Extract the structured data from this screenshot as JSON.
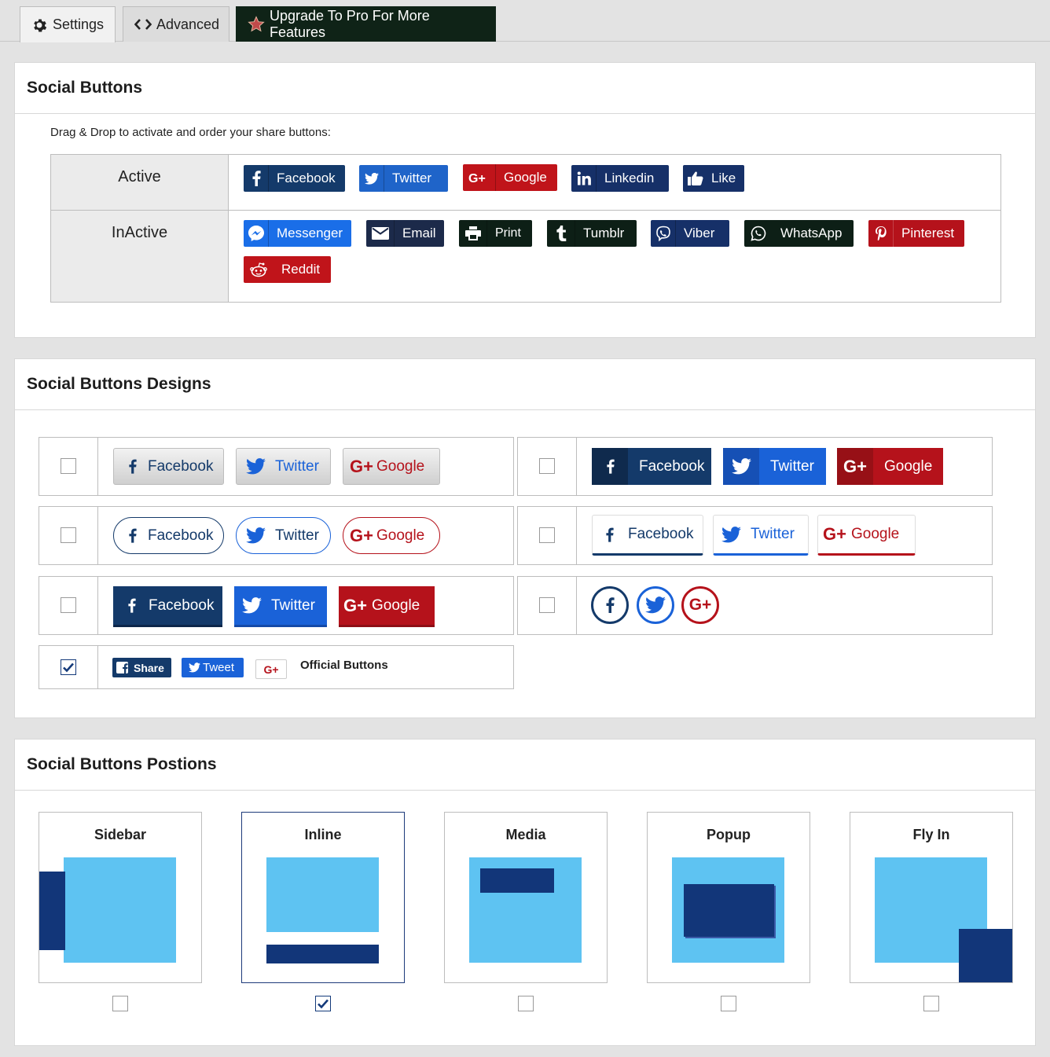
{
  "tabs": {
    "settings": "Settings",
    "advanced": "Advanced",
    "pro": "Upgrade To Pro For More Features"
  },
  "social_buttons": {
    "title": "Social Buttons",
    "instruction": "Drag & Drop to activate and order your share buttons:",
    "active_label": "Active",
    "inactive_label": "InActive",
    "active": [
      {
        "label": "Facebook",
        "icon": "facebook-icon",
        "color": "#143a6a"
      },
      {
        "label": "Twitter",
        "icon": "twitter-icon",
        "color": "#1f64c9"
      },
      {
        "label": "Google",
        "icon": "google-plus-icon",
        "color": "#c0141a"
      },
      {
        "label": "Linkedin",
        "icon": "linkedin-icon",
        "color": "#163068"
      },
      {
        "label": "Like",
        "icon": "thumbs-up-icon",
        "color": "#163068"
      }
    ],
    "inactive": [
      {
        "label": "Messenger",
        "icon": "messenger-icon",
        "color": "#1a6ee8"
      },
      {
        "label": "Email",
        "icon": "email-icon",
        "color": "#1c2a4a"
      },
      {
        "label": "Print",
        "icon": "print-icon",
        "color": "#0d1f16"
      },
      {
        "label": "Tumblr",
        "icon": "tumblr-icon",
        "color": "#0d1f16"
      },
      {
        "label": "Viber",
        "icon": "viber-icon",
        "color": "#163068"
      },
      {
        "label": "WhatsApp",
        "icon": "whatsapp-icon",
        "color": "#0d1f16"
      },
      {
        "label": "Pinterest",
        "icon": "pinterest-icon",
        "color": "#b5121b"
      },
      {
        "label": "Reddit",
        "icon": "reddit-icon",
        "color": "#c0141a"
      }
    ]
  },
  "designs": {
    "title": "Social Buttons Designs",
    "facebook": "Facebook",
    "twitter": "Twitter",
    "google": "Google",
    "official": {
      "share": "Share",
      "tweet": "Tweet",
      "label": "Official Buttons",
      "checked": true
    },
    "colors": {
      "facebook": "#143a6a",
      "twitter": "#1a62d8",
      "google": "#b5121b"
    }
  },
  "positions": {
    "title": "Social Buttons Postions",
    "items": [
      {
        "label": "Sidebar",
        "checked": false
      },
      {
        "label": "Inline",
        "checked": true
      },
      {
        "label": "Media",
        "checked": false
      },
      {
        "label": "Popup",
        "checked": false
      },
      {
        "label": "Fly In",
        "checked": false
      }
    ]
  }
}
